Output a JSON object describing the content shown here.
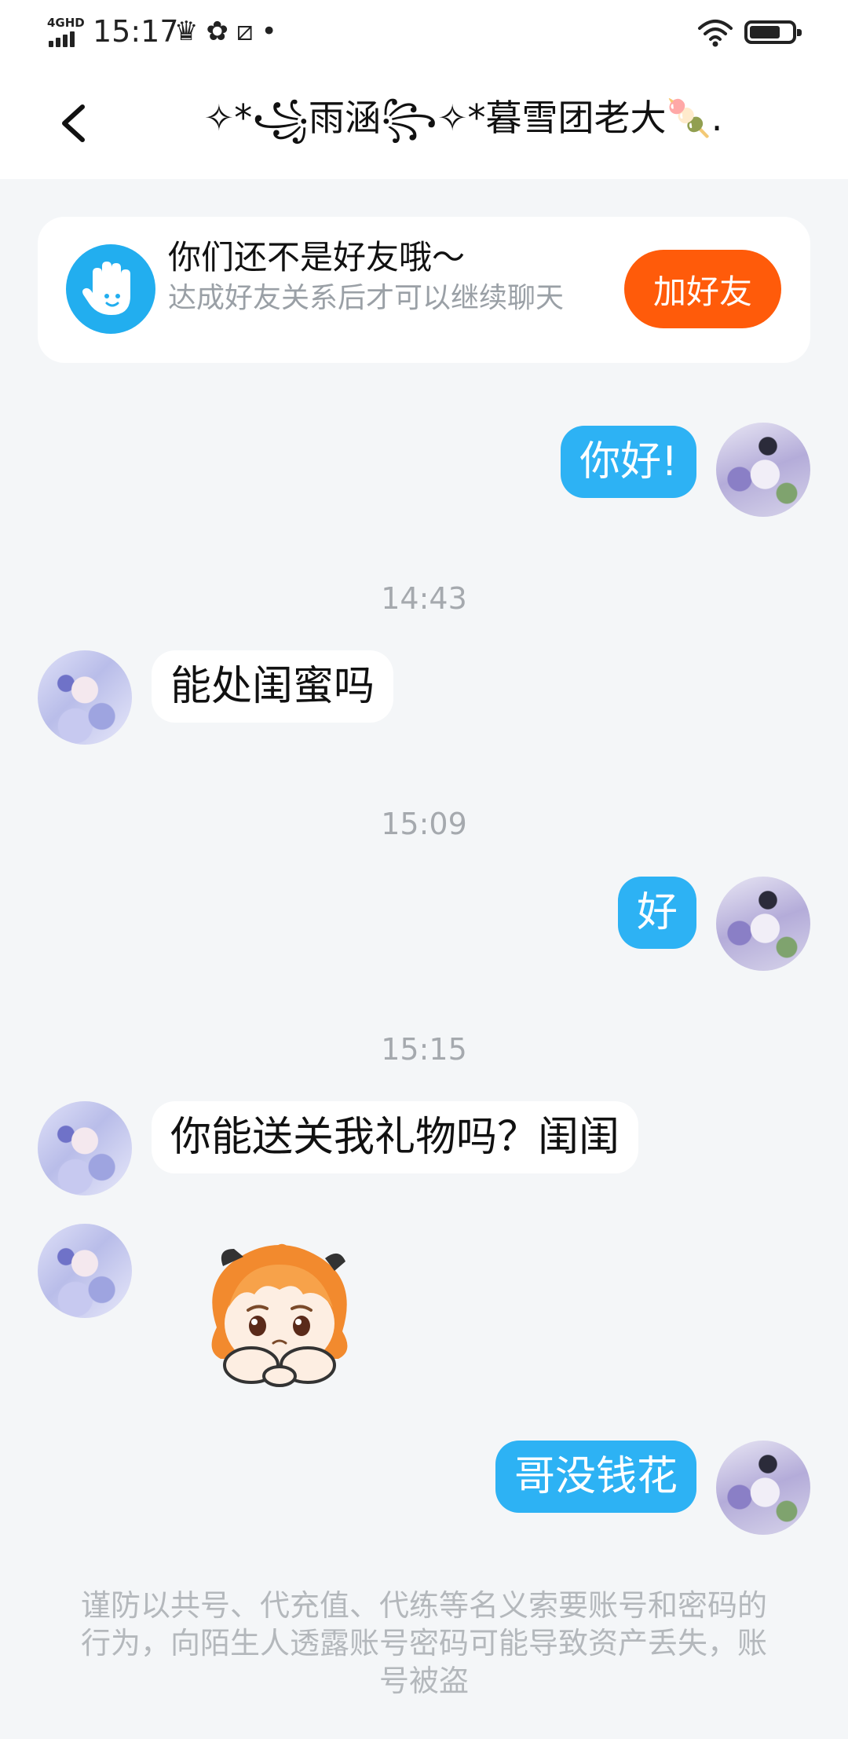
{
  "status_bar": {
    "network": "4GHD",
    "time": "15:17",
    "icons": [
      "crown-icon",
      "fan-icon",
      "screenshot-icon",
      "dot-icon"
    ],
    "icon_glyphs": "♛✿⧄•"
  },
  "header": {
    "back_icon": "chevron-left-icon",
    "title": "✧*꧁雨涵꧂✧*暮雪团老大🍡."
  },
  "friend_notice": {
    "icon": "waving-hand-icon",
    "title": "你们还不是好友哦～",
    "subtitle": "达成好友关系后才可以继续聊天",
    "button_label": "加好友",
    "colors": {
      "button": "#ff5b0a",
      "icon_bg": "#22aeef"
    }
  },
  "messages": [
    {
      "from": "me",
      "text": "你好!"
    },
    {
      "timestamp": "14:43"
    },
    {
      "from": "other",
      "text": "能处闺蜜吗"
    },
    {
      "timestamp": "15:09"
    },
    {
      "from": "me",
      "text": "好"
    },
    {
      "timestamp": "15:15"
    },
    {
      "from": "other",
      "text": "你能送关我礼物吗？闺闺"
    },
    {
      "from": "other",
      "sticker": "sad-chibi-sticker"
    },
    {
      "from": "me",
      "text": "哥没钱花"
    }
  ],
  "footer_notice": "谨防以共号、代充值、代练等名义索要账号和密码的行为，向陌生人透露账号密码可能导致资产丢失，账号被盗",
  "colors": {
    "my_bubble": "#2db2f4",
    "other_bubble": "#ffffff",
    "background": "#f4f6f8"
  }
}
